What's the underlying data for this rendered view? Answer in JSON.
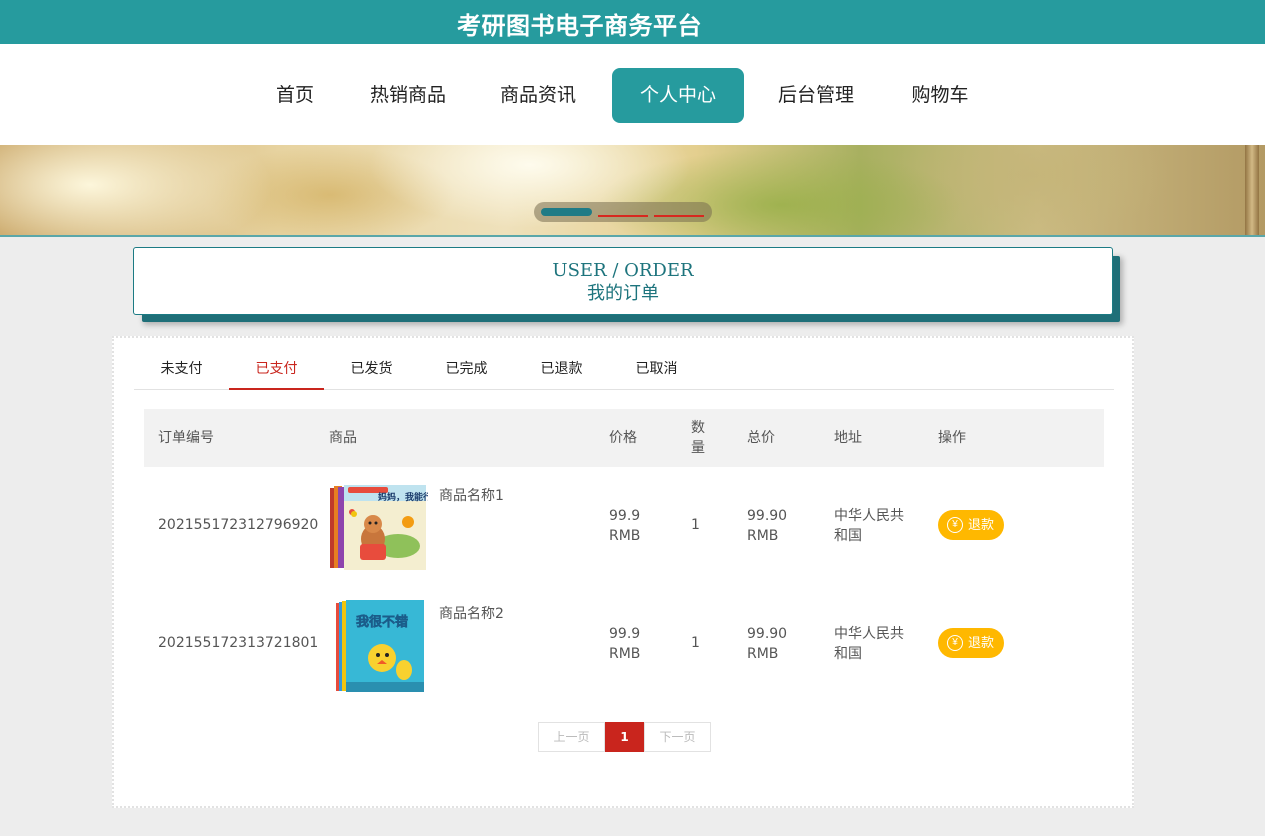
{
  "site_title": "考研图书电子商务平台",
  "nav": [
    {
      "label": "首页",
      "active": false
    },
    {
      "label": "热销商品",
      "active": false
    },
    {
      "label": "商品资讯",
      "active": false
    },
    {
      "label": "个人中心",
      "active": true
    },
    {
      "label": "后台管理",
      "active": false
    },
    {
      "label": "购物车",
      "active": false
    }
  ],
  "carousel": {
    "slide_count": 3,
    "active_index": 0
  },
  "header": {
    "en": "USER / ORDER",
    "cn": "我的订单"
  },
  "tabs": [
    {
      "label": "未支付",
      "active": false
    },
    {
      "label": "已支付",
      "active": true
    },
    {
      "label": "已发货",
      "active": false
    },
    {
      "label": "已完成",
      "active": false
    },
    {
      "label": "已退款",
      "active": false
    },
    {
      "label": "已取消",
      "active": false
    }
  ],
  "table": {
    "columns": {
      "order_no": "订单编号",
      "product": "商品",
      "price": "价格",
      "qty_line1": "数",
      "qty_line2": "量",
      "total": "总价",
      "address": "地址",
      "action": "操作"
    },
    "rows": [
      {
        "order_no": "202155172312796920",
        "product_name": "商品名称1",
        "cover_title": "妈妈，我能行",
        "price_value": "99.9",
        "price_unit": "RMB",
        "qty": "1",
        "total_value": "99.90",
        "total_unit": "RMB",
        "address_line1": "中华人民共",
        "address_line2": "和国",
        "action_label": "退款"
      },
      {
        "order_no": "202155172313721801",
        "product_name": "商品名称2",
        "cover_title": "我很不错",
        "price_value": "99.9",
        "price_unit": "RMB",
        "qty": "1",
        "total_value": "99.90",
        "total_unit": "RMB",
        "address_line1": "中华人民共",
        "address_line2": "和国",
        "action_label": "退款"
      }
    ]
  },
  "pager": {
    "prev": "上一页",
    "current": "1",
    "next": "下一页"
  },
  "colors": {
    "primary": "#269b9e",
    "accent_red": "#c9251d",
    "refund_yellow": "#ffb800"
  }
}
